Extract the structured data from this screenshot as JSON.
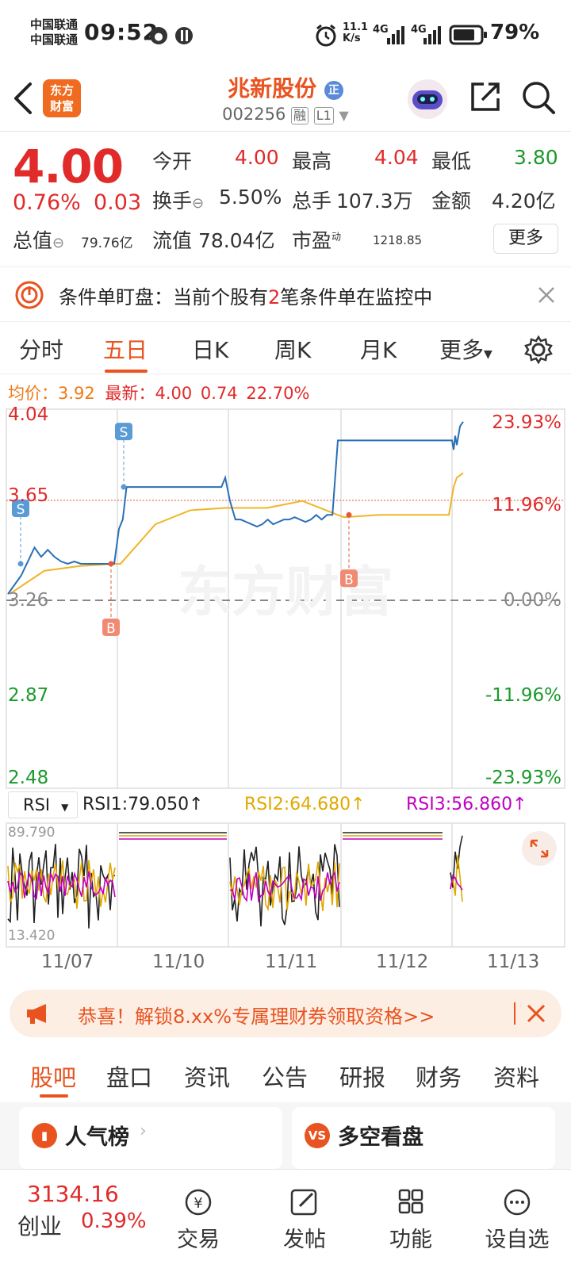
{
  "status_bar": {
    "carrier1": "中国联通",
    "carrier2": "中国联通",
    "time": "09:52",
    "net_speed_top": "11.1",
    "net_speed_bottom": "K/s",
    "signal1": "4G",
    "signal2": "4G",
    "battery": "79%"
  },
  "header": {
    "title": "兆新股份",
    "badge": "正",
    "code": "002256",
    "tag_rong": "融",
    "tag_level": "L1",
    "logo_line1": "东方",
    "logo_line2": "财富"
  },
  "quote": {
    "price": "4.00",
    "change_pct": "0.76%",
    "change_amt": "0.03",
    "open_label": "今开",
    "open_value": "4.00",
    "high_label": "最高",
    "high_value": "4.04",
    "low_label": "最低",
    "low_value": "3.80",
    "turnover_label": "换手",
    "turnover_value": "5.50%",
    "volume_label": "总手",
    "volume_value": "107.3万",
    "amount_label": "金额",
    "amount_value": "4.20亿",
    "mktcap_label": "总值",
    "mktcap_value": "79.76亿",
    "float_label": "流值",
    "float_value": "78.04亿",
    "pe_label": "市盈",
    "pe_sup": "动",
    "pe_value": "1218.85",
    "more_button": "更多"
  },
  "notice": {
    "text_before": "条件单盯盘：当前个股有",
    "count": "2",
    "text_after": "笔条件单在监控中"
  },
  "chart_tabs": [
    "分时",
    "五日",
    "日K",
    "周K",
    "月K",
    "更多"
  ],
  "active_tab": "五日",
  "legend": {
    "avg_label": "均价：",
    "avg_value": "3.92",
    "latest_label": "最新：",
    "latest_value": "4.00",
    "latest_change": "0.74",
    "latest_pct": "22.70%"
  },
  "chart_data": {
    "type": "line",
    "title": "五日",
    "x_labels": [
      "11/07",
      "11/10",
      "11/11",
      "11/12",
      "11/13"
    ],
    "y_left_ticks": [
      "4.04",
      "3.65",
      "3.26",
      "2.87",
      "2.48"
    ],
    "y_right_ticks": [
      "23.93%",
      "11.96%",
      "0.00%",
      "-11.96%",
      "-23.93%"
    ],
    "ylim": [
      2.48,
      4.04
    ],
    "baseline": 3.26,
    "series": [
      {
        "name": "最新",
        "color": "#2a6fb5",
        "x": [
          0,
          4,
          8,
          12,
          16,
          20,
          24,
          28,
          32,
          36,
          40,
          50,
          60,
          70,
          80,
          90,
          100,
          100,
          101,
          104,
          108,
          112,
          116,
          120,
          124,
          128,
          132,
          136,
          140,
          144,
          148,
          152,
          156,
          160,
          164,
          168,
          172,
          176,
          180,
          184,
          188,
          192,
          196,
          198,
          200,
          201,
          202,
          204,
          206,
          208,
          212,
          216,
          220,
          224,
          228,
          232,
          236,
          240,
          244,
          248,
          252,
          256,
          260,
          262,
          263,
          266,
          300,
          340,
          380,
          400,
          405,
          410,
          420,
          440,
          470,
          500
        ],
        "y": [
          3.28,
          3.32,
          3.36,
          3.42,
          3.48,
          3.44,
          3.47,
          3.44,
          3.42,
          3.41,
          3.42,
          3.41,
          3.41,
          3.41,
          3.41,
          3.41,
          3.41,
          3.56,
          3.6,
          3.74,
          3.74,
          3.74,
          3.74,
          3.74,
          3.74,
          3.74,
          3.74,
          3.74,
          3.74,
          3.74,
          3.74,
          3.74,
          3.74,
          3.74,
          3.74,
          3.74,
          3.74,
          3.74,
          3.74,
          3.74,
          3.74,
          3.74,
          3.74,
          3.74,
          3.74,
          3.78,
          3.68,
          3.6,
          3.6,
          3.59,
          3.58,
          3.57,
          3.58,
          3.6,
          3.58,
          3.59,
          3.6,
          3.6,
          3.61,
          3.6,
          3.59,
          3.6,
          3.62,
          3.6,
          3.62,
          3.62,
          3.94,
          3.94,
          3.94,
          3.94,
          3.94,
          3.94,
          3.94,
          3.94,
          3.94,
          3.94
        ],
        "_note": "x in minutes-like sequence; rendered proportionally"
      },
      {
        "name": "均价",
        "color": "#f0b429",
        "y": [
          3.28,
          3.38,
          3.4,
          3.41,
          3.41,
          3.58,
          3.64,
          3.65,
          3.65,
          3.65,
          3.68,
          3.62,
          3.61,
          3.62,
          3.62,
          3.62,
          3.74,
          3.78,
          3.79,
          3.8
        ]
      }
    ],
    "markers": [
      {
        "label": "S",
        "day": "11/07",
        "value": 3.41
      },
      {
        "label": "B",
        "day": "11/07",
        "value": 3.41
      },
      {
        "label": "S",
        "day": "11/10",
        "value": 3.74
      },
      {
        "label": "B",
        "day": "11/12",
        "value": 3.62
      }
    ]
  },
  "rsi": {
    "selector": "RSI",
    "rsi1_label": "RSI1:79.050",
    "rsi2_label": "RSI2:64.680",
    "rsi3_label": "RSI3:56.860",
    "up_arrow": "↑",
    "y_top": "89.790",
    "y_bottom": "13.420",
    "rsi1_color": "#222222",
    "rsi2_color": "#e0a800",
    "rsi3_color": "#c000c0"
  },
  "watermark": "东方财富",
  "banner": {
    "text": "恭喜！解锁8.xx%专属理财券领取资格>>"
  },
  "bottom_tabs": [
    "股吧",
    "盘口",
    "资讯",
    "公告",
    "研报",
    "财务",
    "资料"
  ],
  "active_bottom_tab": "股吧",
  "cards": [
    {
      "title": "人气榜",
      "icon": "bar-chart-icon"
    },
    {
      "title": "多空看盘",
      "icon": "vs-icon"
    }
  ],
  "bottom_nav": {
    "index_value": "3134.16",
    "index_name": "创业",
    "index_pct": "0.39%",
    "items": [
      "交易",
      "发帖",
      "功能",
      "设自选"
    ]
  },
  "colors": {
    "accent": "#e8531f",
    "up": "#e12a2a",
    "down": "#1a9a2a",
    "price_line": "#2a6fb5",
    "avg_line": "#f0b429"
  }
}
